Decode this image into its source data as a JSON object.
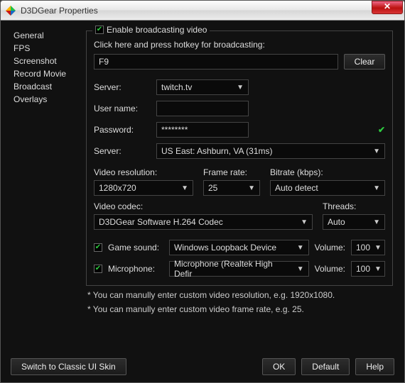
{
  "window": {
    "title": "D3DGear Properties"
  },
  "sidebar": {
    "items": [
      "General",
      "FPS",
      "Screenshot",
      "Record Movie",
      "Broadcast",
      "Overlays"
    ]
  },
  "group": {
    "enable_label": "Enable broadcasting video",
    "hotkey_prompt": "Click here and press hotkey for broadcasting:",
    "hotkey_value": "F9",
    "clear_label": "Clear"
  },
  "fields": {
    "server_label": "Server:",
    "server_value": "twitch.tv",
    "username_label": "User name:",
    "username_value": " ",
    "password_label": "Password:",
    "password_value": "********",
    "server2_label": "Server:",
    "server2_value": "US East: Ashburn, VA    (31ms)"
  },
  "video": {
    "res_label": "Video resolution:",
    "res_value": "1280x720",
    "fps_label": "Frame rate:",
    "fps_value": "25",
    "bitrate_label": "Bitrate (kbps):",
    "bitrate_value": "Auto detect",
    "codec_label": "Video codec:",
    "codec_value": "D3DGear Software H.264 Codec",
    "threads_label": "Threads:",
    "threads_value": "Auto"
  },
  "audio": {
    "game_label": "Game sound:",
    "game_value": "Windows Loopback Device",
    "mic_label": "Microphone:",
    "mic_value": "Microphone (Realtek High Defir",
    "volume_label": "Volume:",
    "game_vol": "100",
    "mic_vol": "100"
  },
  "notes": {
    "n1": "* You can manully enter custom video resolution, e.g. 1920x1080.",
    "n2": "* You can manully enter custom video frame rate, e.g. 25."
  },
  "footer": {
    "skin": "Switch to Classic UI Skin",
    "ok": "OK",
    "default": "Default",
    "help": "Help"
  }
}
